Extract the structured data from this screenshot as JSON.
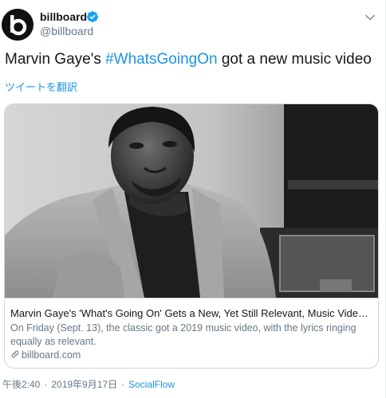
{
  "header": {
    "name": "billboard",
    "handle": "@billboard",
    "avatar_text": "billboard"
  },
  "tweet": {
    "text_before": "Marvin Gaye's ",
    "hashtag": "#WhatsGoingOn",
    "text_after": " got a new music video",
    "translate_label": "ツイートを翻訳"
  },
  "card": {
    "title": "Marvin Gaye's 'What's Going On' Gets a New, Yet Still Relevant, Music Video: W...",
    "description": "On Friday (Sept. 13), the classic got a 2019 music video, with the lyrics ringing equally as relevant.",
    "domain": "billboard.com"
  },
  "meta": {
    "time": "午後2:40",
    "separator": "·",
    "date": "2019年9月17日",
    "source": "SocialFlow"
  },
  "colors": {
    "link": "#1b95e0",
    "verified": "#1da1f2",
    "secondary_text": "#657786",
    "border": "#ccd6dd"
  },
  "icons": [
    "verified-badge-icon",
    "chevron-down-icon",
    "link-icon"
  ]
}
